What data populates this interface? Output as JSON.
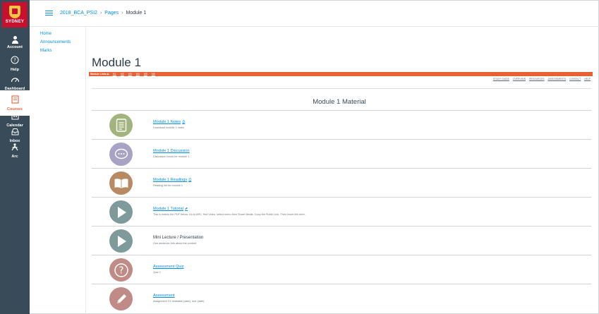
{
  "global_nav": {
    "logo_text": "SYDNEY",
    "items": [
      {
        "label": "Account",
        "icon": "account-icon"
      },
      {
        "label": "Help",
        "icon": "help-icon"
      },
      {
        "label": "Dashboard",
        "icon": "dashboard-icon"
      },
      {
        "label": "Courses",
        "icon": "courses-icon",
        "active": true
      },
      {
        "label": "Calendar",
        "icon": "calendar-icon"
      },
      {
        "label": "Inbox",
        "icon": "inbox-icon"
      },
      {
        "label": "Arc",
        "icon": "arc-icon"
      }
    ]
  },
  "breadcrumb": {
    "course": "2018_BCA_PSI2",
    "section": "Pages",
    "current": "Module 1"
  },
  "course_nav": [
    "Home",
    "Announcements",
    "Marks"
  ],
  "page": {
    "title": "Module 1",
    "module_bar_label": "Module Links ▶",
    "module_links": [
      "M1",
      "M2",
      "M3",
      "M4",
      "M5",
      "M6"
    ],
    "right_links": [
      "STUDY GUIDE",
      "OVERVIEW",
      "RESOURCES",
      "ASSESSMENTS",
      "CONTACT",
      "HELP"
    ],
    "material_title": "Module 1 Material"
  },
  "items": [
    {
      "title": "Module 1 Notes",
      "subtitle": "Download module 1 notes",
      "icon": "notes-icon",
      "color": "#a3b37e",
      "link": true,
      "ext": "⎙"
    },
    {
      "title": "Module 1 Discussion",
      "subtitle": "Discussion forum for module 1",
      "icon": "discussion-icon",
      "color": "#a8a2c4",
      "link": true,
      "ext": ""
    },
    {
      "title": "Module 1 Readings",
      "subtitle": "Reading list for module 1",
      "icon": "readings-icon",
      "color": "#b88a63",
      "link": true,
      "ext": "⎙"
    },
    {
      "title": "Module 1 Tutorial",
      "subtitle": "This is mainly the PDF below. Go to ARC, find Video, select menu then Share Media. Copy the Public Link. Then insert link here.",
      "icon": "play-icon",
      "color": "#7e9a9a",
      "link": true,
      "ext": "⬈"
    },
    {
      "title": "Mini Lecture / Presentation",
      "subtitle": "One sentence info about the content",
      "icon": "play-icon",
      "color": "#7e9a9a",
      "link": false,
      "ext": ""
    },
    {
      "title": "Assessment Quiz",
      "subtitle": "Quiz 1",
      "icon": "quiz-icon",
      "color": "#c08a86",
      "link": true,
      "ext": ""
    },
    {
      "title": "Assessment",
      "subtitle": "Assignment XX available (date), due (date)",
      "icon": "pencil-icon",
      "color": "#c08a86",
      "link": true,
      "ext": ""
    }
  ]
}
